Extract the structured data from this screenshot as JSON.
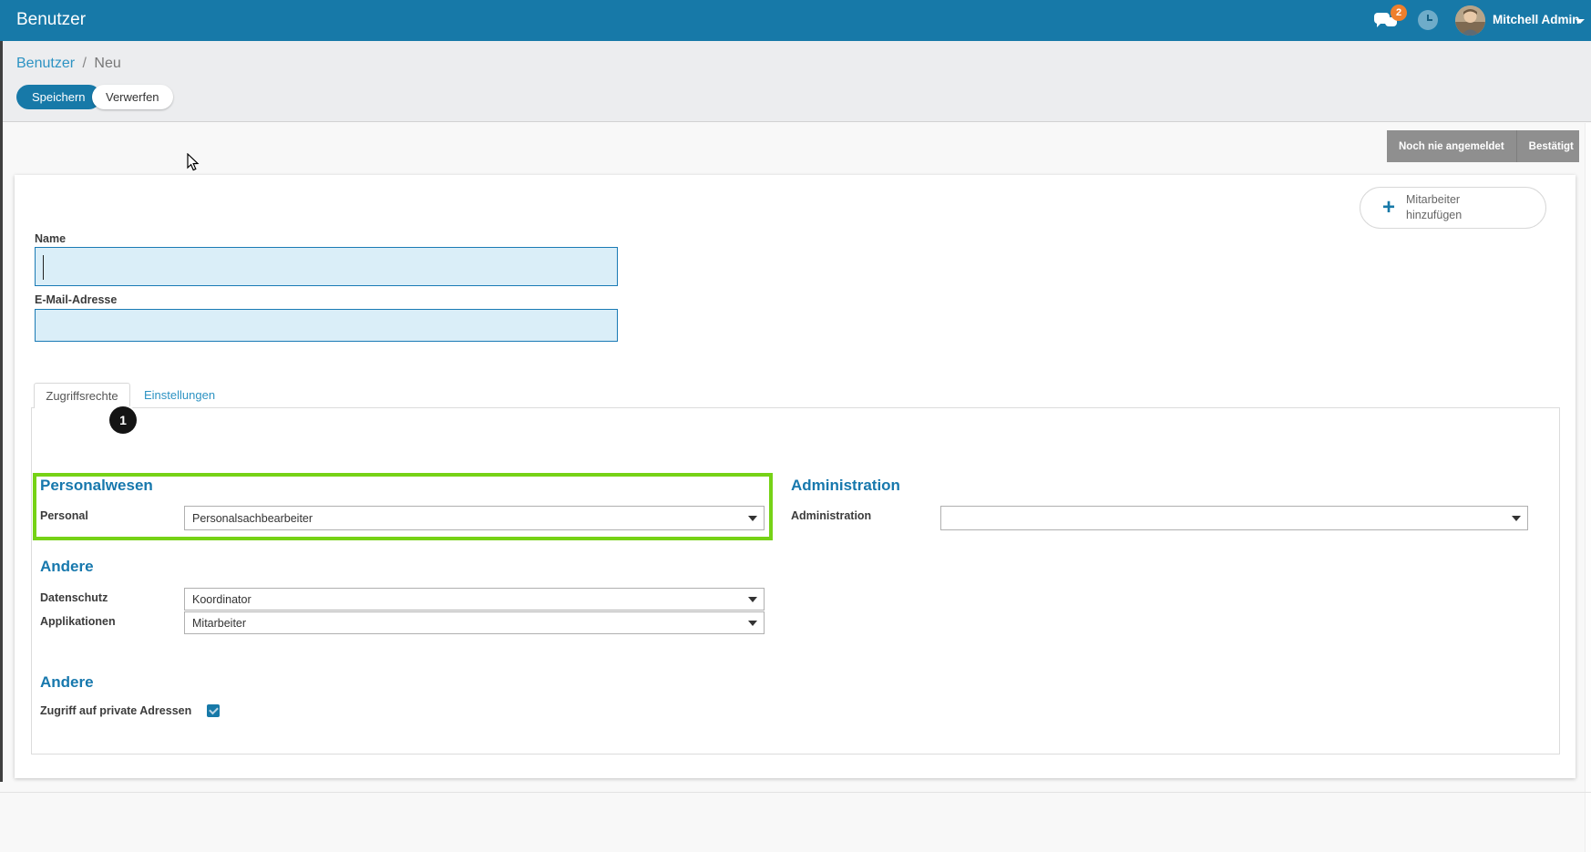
{
  "app_bar": {
    "title": "Benutzer",
    "messages_badge": "2",
    "user_name": "Mitchell Admin"
  },
  "control_panel": {
    "breadcrumb": [
      "Benutzer",
      "Neu"
    ],
    "save_label": "Speichern",
    "discard_label": "Verwerfen"
  },
  "statusbar": {
    "buttons": [
      {
        "label": "Noch nie angemeldet"
      },
      {
        "label": "Bestätigt"
      }
    ]
  },
  "form": {
    "add_employee_button": {
      "line1": "Mitarbeiter",
      "line2": "hinzufügen"
    },
    "fields": {
      "name_label": "Name",
      "name_value": "",
      "email_label": "E-Mail-Adresse",
      "email_value": ""
    },
    "tabs": [
      {
        "label": "Zugriffsrechte",
        "active": true
      },
      {
        "label": "Einstellungen",
        "active": false
      }
    ],
    "annotation_badge": "1",
    "sections": {
      "personalwesen": {
        "title": "Personalwesen",
        "field_label": "Personal",
        "value": "Personalsachbearbeiter",
        "highlighted": true
      },
      "administration": {
        "title": "Administration",
        "field_label": "Administration",
        "value": ""
      },
      "andere1": {
        "title": "Andere",
        "fields": [
          {
            "label": "Datenschutz",
            "value": "Koordinator"
          },
          {
            "label": "Applikationen",
            "value": "Mitarbeiter"
          }
        ]
      },
      "andere2": {
        "title": "Andere",
        "checkbox_label": "Zugriff auf private Adressen",
        "checked": true
      }
    }
  },
  "colors": {
    "primary_blue": "#1779a8",
    "link_blue": "#2d93c3",
    "heading_blue": "#1778ad",
    "input_bg_blue": "#daeef8",
    "highlight_green": "#76d216",
    "status_gray": "#8f8f8f",
    "badge_orange": "#ee7f2d"
  }
}
